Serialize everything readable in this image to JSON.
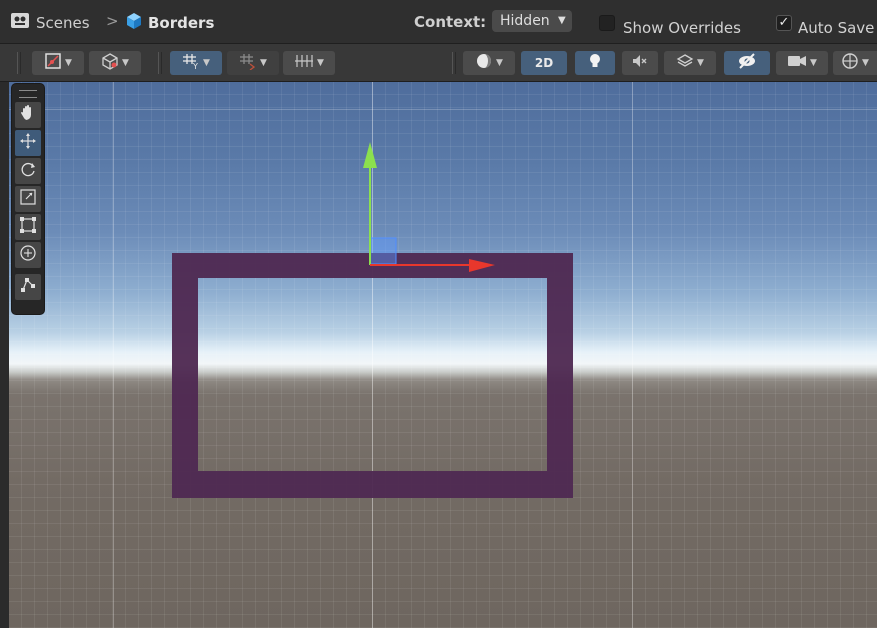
{
  "breadcrumb": {
    "root": "Scenes",
    "separator": ">",
    "current": "Borders"
  },
  "context": {
    "label": "Context:",
    "value": "Hidden"
  },
  "options": {
    "show_overrides": {
      "label": "Show Overrides",
      "checked": false
    },
    "auto_save": {
      "label": "Auto Save",
      "checked": true
    }
  },
  "toolbar": {
    "mode_2d_label": "2D",
    "buttons": [
      "tool-handle-position",
      "view-options",
      "grid-snapping",
      "increment-snap",
      "grid-visibility",
      "draw-mode",
      "2d-toggle",
      "lighting",
      "audio",
      "effects",
      "scene-visibility",
      "camera",
      "gizmos"
    ]
  },
  "tools": [
    "view-tool",
    "move-tool",
    "rotate-tool",
    "scale-tool",
    "rect-tool",
    "transform-tool",
    "custom-editor-tool"
  ],
  "active_tool": "move-tool",
  "scene": {
    "object": "rectangular border frame",
    "frame_color": "#4f2a52",
    "x_axis_color": "#e8372c",
    "y_axis_color": "#8be04e"
  }
}
